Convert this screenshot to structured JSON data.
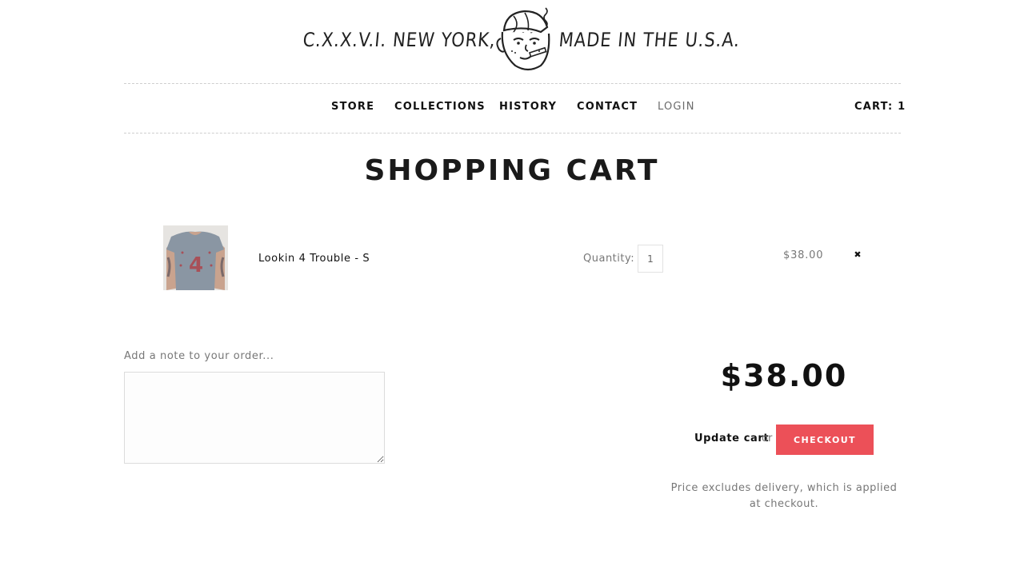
{
  "brand": {
    "left_text": "C.X.X.V.I. NEW YORK, N.Y.",
    "right_text": "MADE IN THE U.S.A.",
    "mascot_icon": "smoking-kid-icon"
  },
  "nav": {
    "items": [
      {
        "label": "STORE"
      },
      {
        "label": "COLLECTIONS"
      },
      {
        "label": "HISTORY"
      },
      {
        "label": "CONTACT"
      },
      {
        "label": "LOGIN"
      }
    ],
    "cart_label": "CART: 1"
  },
  "page": {
    "title": "SHOPPING CART"
  },
  "cart": {
    "items": [
      {
        "name": "Lookin 4 Trouble - S",
        "quantity_label": "Quantity:",
        "quantity": "1",
        "price": "$38.00",
        "remove_icon": "close-icon"
      }
    ],
    "note_label": "Add a note to your order...",
    "note_value": "",
    "total": "$38.00",
    "update_label": "Update cart",
    "or_label": "or",
    "checkout_label": "CHECKOUT",
    "disclaimer": "Price excludes delivery, which is applied at checkout."
  },
  "colors": {
    "accent": "#ec5058",
    "text": "#111111",
    "muted": "#777777"
  }
}
